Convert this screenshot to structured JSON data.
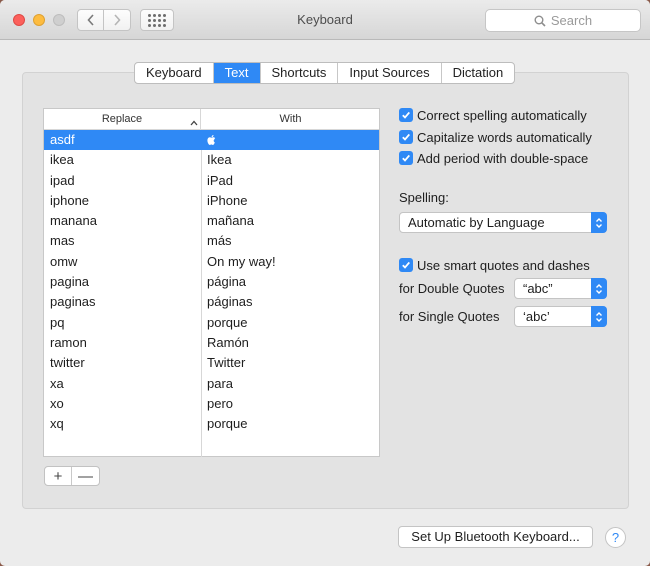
{
  "window": {
    "title": "Keyboard"
  },
  "search": {
    "placeholder": "Search"
  },
  "tabs": [
    {
      "label": "Keyboard",
      "active": false
    },
    {
      "label": "Text",
      "active": true
    },
    {
      "label": "Shortcuts",
      "active": false
    },
    {
      "label": "Input Sources",
      "active": false
    },
    {
      "label": "Dictation",
      "active": false
    }
  ],
  "table": {
    "headers": {
      "replace": "Replace",
      "with": "With"
    },
    "rows": [
      {
        "replace": "asdf",
        "with": "",
        "with_icon": "apple-logo-icon",
        "selected": true
      },
      {
        "replace": "ikea",
        "with": "Ikea"
      },
      {
        "replace": "ipad",
        "with": "iPad"
      },
      {
        "replace": "iphone",
        "with": "iPhone"
      },
      {
        "replace": "manana",
        "with": "mañana"
      },
      {
        "replace": "mas",
        "with": "más"
      },
      {
        "replace": "omw",
        "with": "On my way!"
      },
      {
        "replace": "pagina",
        "with": "página"
      },
      {
        "replace": "paginas",
        "with": "páginas"
      },
      {
        "replace": "pq",
        "with": "porque"
      },
      {
        "replace": "ramon",
        "with": "Ramón"
      },
      {
        "replace": "twitter",
        "with": "Twitter"
      },
      {
        "replace": "xa",
        "with": "para"
      },
      {
        "replace": "xo",
        "with": "pero"
      },
      {
        "replace": "xq",
        "with": "porque"
      }
    ]
  },
  "buttons": {
    "add": "+",
    "remove": "—",
    "bluetooth": "Set Up Bluetooth Keyboard...",
    "help": "?"
  },
  "options": {
    "correct_spelling": "Correct spelling automatically",
    "capitalize": "Capitalize words automatically",
    "add_period": "Add period with double-space",
    "spelling_label": "Spelling:",
    "spelling_value": "Automatic by Language",
    "smart_quotes": "Use smart quotes and dashes",
    "double_quotes_label": "for Double Quotes",
    "double_quotes_value": "“abc”",
    "single_quotes_label": "for Single Quotes",
    "single_quotes_value": "‘abc’"
  },
  "colors": {
    "accent": "#2f89f5"
  }
}
